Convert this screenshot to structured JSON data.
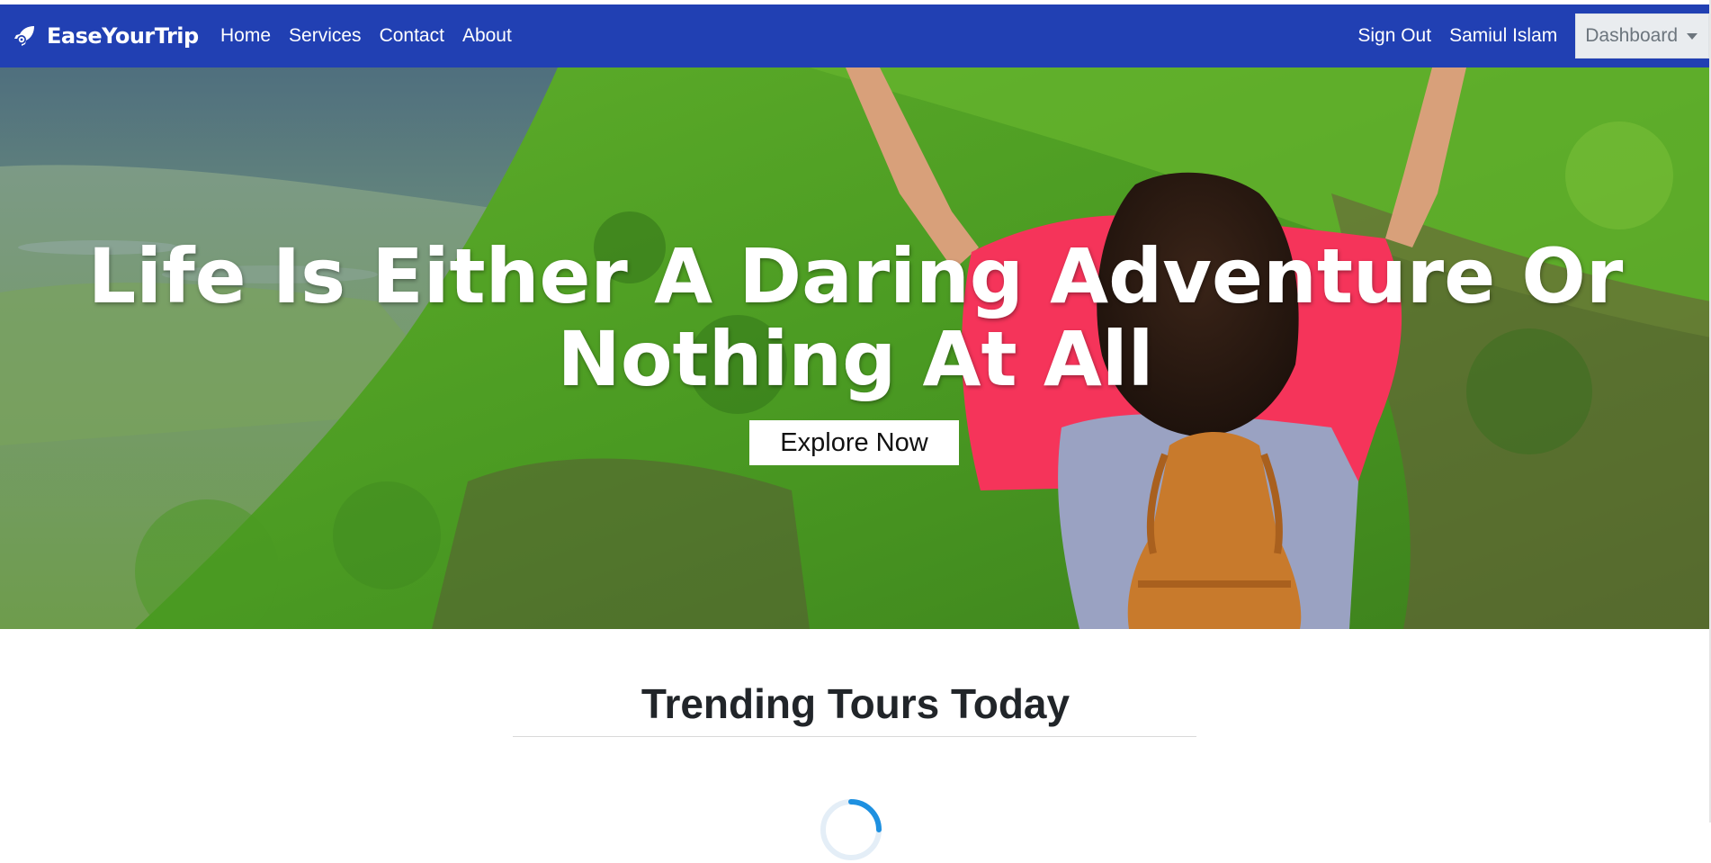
{
  "brand": {
    "name": "EaseYourTrip",
    "icon": "rocket-icon"
  },
  "nav": {
    "links": [
      "Home",
      "Services",
      "Contact",
      "About"
    ],
    "sign_out": "Sign Out",
    "user_name": "Samiul Islam",
    "dashboard": "Dashboard"
  },
  "hero": {
    "heading": "Life Is Either A Daring Adventure Or Nothing At All",
    "button": "Explore Now"
  },
  "trending": {
    "title": "Trending Tours Today"
  },
  "colors": {
    "navbar": "#2140b3",
    "spinner": "#1e90e0"
  }
}
